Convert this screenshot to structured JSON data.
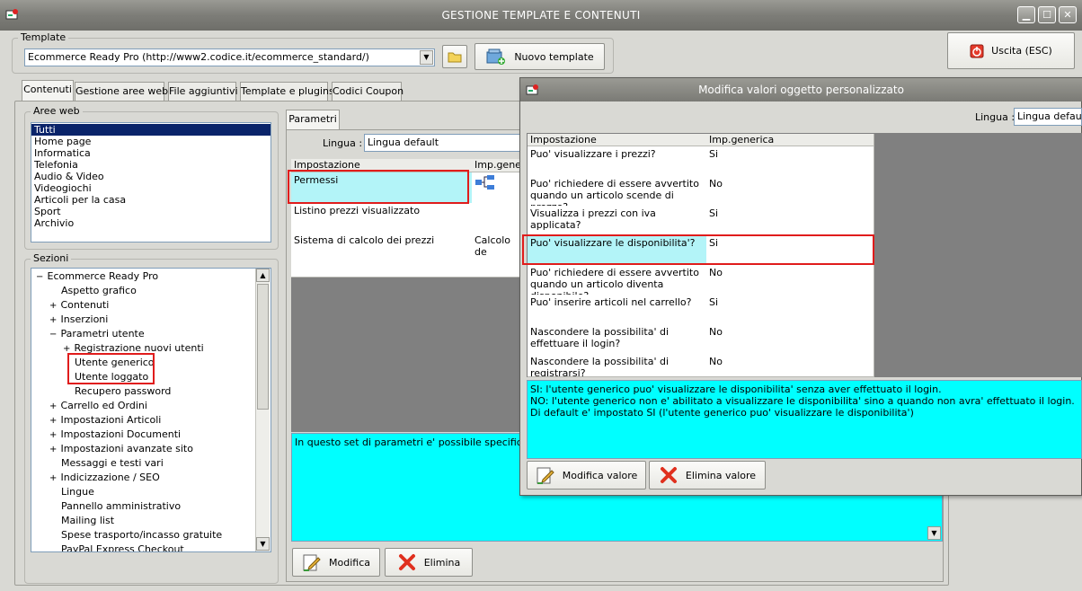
{
  "window": {
    "title": "GESTIONE TEMPLATE E CONTENUTI",
    "min": "▁",
    "max": "☐",
    "close": "✕"
  },
  "template": {
    "group_label": "Template",
    "combo_value": "Ecommerce Ready Pro (http://www2.codice.it/ecommerce_standard/)",
    "new_button": "Nuovo template",
    "exit_button": "Uscita (ESC)"
  },
  "tabs": [
    "Contenuti",
    "Gestione aree web",
    "File aggiuntivi",
    "Template e plugins",
    "Codici Coupon"
  ],
  "aree_web": {
    "label": "Aree web",
    "items": [
      "Tutti",
      "Home page",
      "Informatica",
      "Telefonia",
      "Audio & Video",
      "Videogiochi",
      "Articoli per la casa",
      "Sport",
      "Archivio"
    ]
  },
  "sezioni": {
    "label": "Sezioni",
    "items": [
      {
        "exp": "−",
        "label": "Ecommerce Ready Pro"
      },
      {
        "exp": "",
        "label": "Aspetto grafico"
      },
      {
        "exp": "+",
        "label": "Contenuti"
      },
      {
        "exp": "+",
        "label": "Inserzioni"
      },
      {
        "exp": "−",
        "label": "Parametri utente"
      },
      {
        "exp": "+",
        "label": "Registrazione nuovi utenti"
      },
      {
        "exp": "",
        "label": "Utente generico"
      },
      {
        "exp": "",
        "label": "Utente loggato"
      },
      {
        "exp": "",
        "label": "Recupero password"
      },
      {
        "exp": "+",
        "label": "Carrello ed Ordini"
      },
      {
        "exp": "+",
        "label": "Impostazioni Articoli"
      },
      {
        "exp": "+",
        "label": "Impostazioni Documenti"
      },
      {
        "exp": "+",
        "label": "Impostazioni avanzate sito"
      },
      {
        "exp": "",
        "label": "Messaggi e testi vari"
      },
      {
        "exp": "+",
        "label": "Indicizzazione / SEO"
      },
      {
        "exp": "",
        "label": "Lingue"
      },
      {
        "exp": "",
        "label": "Pannello amministrativo"
      },
      {
        "exp": "",
        "label": "Mailing list"
      },
      {
        "exp": "",
        "label": "Spese trasporto/incasso gratuite"
      },
      {
        "exp": "",
        "label": "PayPal Express Checkout"
      }
    ]
  },
  "parametri": {
    "tab": "Parametri",
    "lingua_label": "Lingua :",
    "lingua_value": "Lingua default",
    "col_impostazione": "Impostazione",
    "col_imp": "Imp.generica",
    "rows": [
      {
        "name": "Permessi",
        "value": ""
      },
      {
        "name": "Listino prezzi visualizzato",
        "value": ""
      },
      {
        "name": "Sistema di calcolo dei prezzi",
        "value": "Calcolo de"
      }
    ],
    "description": "In questo set di parametri e' possibile specificare le a",
    "modifica": "Modifica",
    "elimina": "Elimina"
  },
  "dialog": {
    "title": "Modifica valori oggetto personalizzato",
    "lingua_label": "Lingua :",
    "lingua_value": "Lingua default",
    "col_impostazione": "Impostazione",
    "col_imp": "Imp.generica",
    "rows": [
      {
        "name": "Puo' visualizzare i prezzi?",
        "value": "Si"
      },
      {
        "name": "Puo' richiedere di essere avvertito quando un articolo scende di prezzo?",
        "value": "No"
      },
      {
        "name": "Visualizza i prezzi con iva applicata?",
        "value": "Si"
      },
      {
        "name": "Puo' visualizzare le disponibilita'?",
        "value": "Si"
      },
      {
        "name": "Puo' richiedere di essere avvertito quando un articolo diventa disponibile?",
        "value": "No"
      },
      {
        "name": "Puo' inserire articoli nel carrello?",
        "value": "Si"
      },
      {
        "name": "Nascondere la possibilita' di effettuare il login?",
        "value": "No"
      },
      {
        "name": "Nascondere la possibilita' di registrarsi?",
        "value": "No"
      }
    ],
    "desc_1": "SI: l'utente generico puo' visualizzare le disponibilita' senza aver effettuato il login.",
    "desc_2": "NO: l'utente generico non e' abilitato a visualizzare le disponibilita' sino a quando non avra' effettuato il login.",
    "desc_3": "Di default e' impostato SI (l'utente generico puo' visualizzare le disponibilita')",
    "modifica_valore": "Modifica valore",
    "elimina_valore": "Elimina valore"
  },
  "colors": {
    "highlight": "#e01c1c",
    "description_bg": "#00ffff",
    "selection": "#0a246a"
  }
}
